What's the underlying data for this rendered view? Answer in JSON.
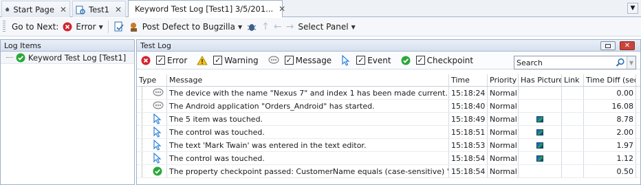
{
  "tabs": [
    {
      "label": "Start Page",
      "icon": "home-icon"
    },
    {
      "label": "Test1",
      "icon": "project-icon"
    },
    {
      "label": "Keyword Test Log [Test1] 3/5/201...",
      "icon": "log-icon"
    }
  ],
  "toolbar": {
    "go_to_next": "Go to Next:",
    "error": "Error",
    "post_defect": "Post Defect to Bugzilla",
    "select_panel": "Select Panel"
  },
  "left_panel": {
    "title": "Log Items",
    "item": "Keyword Test Log [Test1]"
  },
  "right_panel": {
    "title": "Test Log"
  },
  "filters": [
    {
      "label": "Error",
      "icon": "error-icon"
    },
    {
      "label": "Warning",
      "icon": "warning-icon"
    },
    {
      "label": "Message",
      "icon": "message-icon"
    },
    {
      "label": "Event",
      "icon": "event-icon"
    },
    {
      "label": "Checkpoint",
      "icon": "checkpoint-icon"
    }
  ],
  "search": {
    "value": "Search"
  },
  "columns": [
    "Type",
    "Message",
    "Time",
    "Priority",
    "Has Picture",
    "Link",
    "Time Diff (sec)"
  ],
  "rows": [
    {
      "type": "message",
      "message": "The device with the name \"Nexus 7\" and index 1 has been made current.",
      "time": "15:18:24",
      "priority": "Normal",
      "pic": false,
      "diff": "0.00"
    },
    {
      "type": "message",
      "message": "The Android application \"Orders_Android\" has started.",
      "time": "15:18:40",
      "priority": "Normal",
      "pic": false,
      "diff": "16.08"
    },
    {
      "type": "event",
      "message": "The 5 item was touched.",
      "time": "15:18:49",
      "priority": "Normal",
      "pic": true,
      "diff": "8.78"
    },
    {
      "type": "event",
      "message": "The control was touched.",
      "time": "15:18:51",
      "priority": "Normal",
      "pic": true,
      "diff": "2.00"
    },
    {
      "type": "event",
      "message": "The text 'Mark Twain' was entered in the text editor.",
      "time": "15:18:53",
      "priority": "Normal",
      "pic": true,
      "diff": "1.97"
    },
    {
      "type": "event",
      "message": "The control was touched.",
      "time": "15:18:54",
      "priority": "Normal",
      "pic": true,
      "diff": "1.12"
    },
    {
      "type": "checkpoint",
      "message": "The property checkpoint passed: CustomerName equals (case-sensitive) \"Mark T...",
      "time": "15:18:54",
      "priority": "Normal",
      "pic": false,
      "diff": "0.50"
    }
  ]
}
